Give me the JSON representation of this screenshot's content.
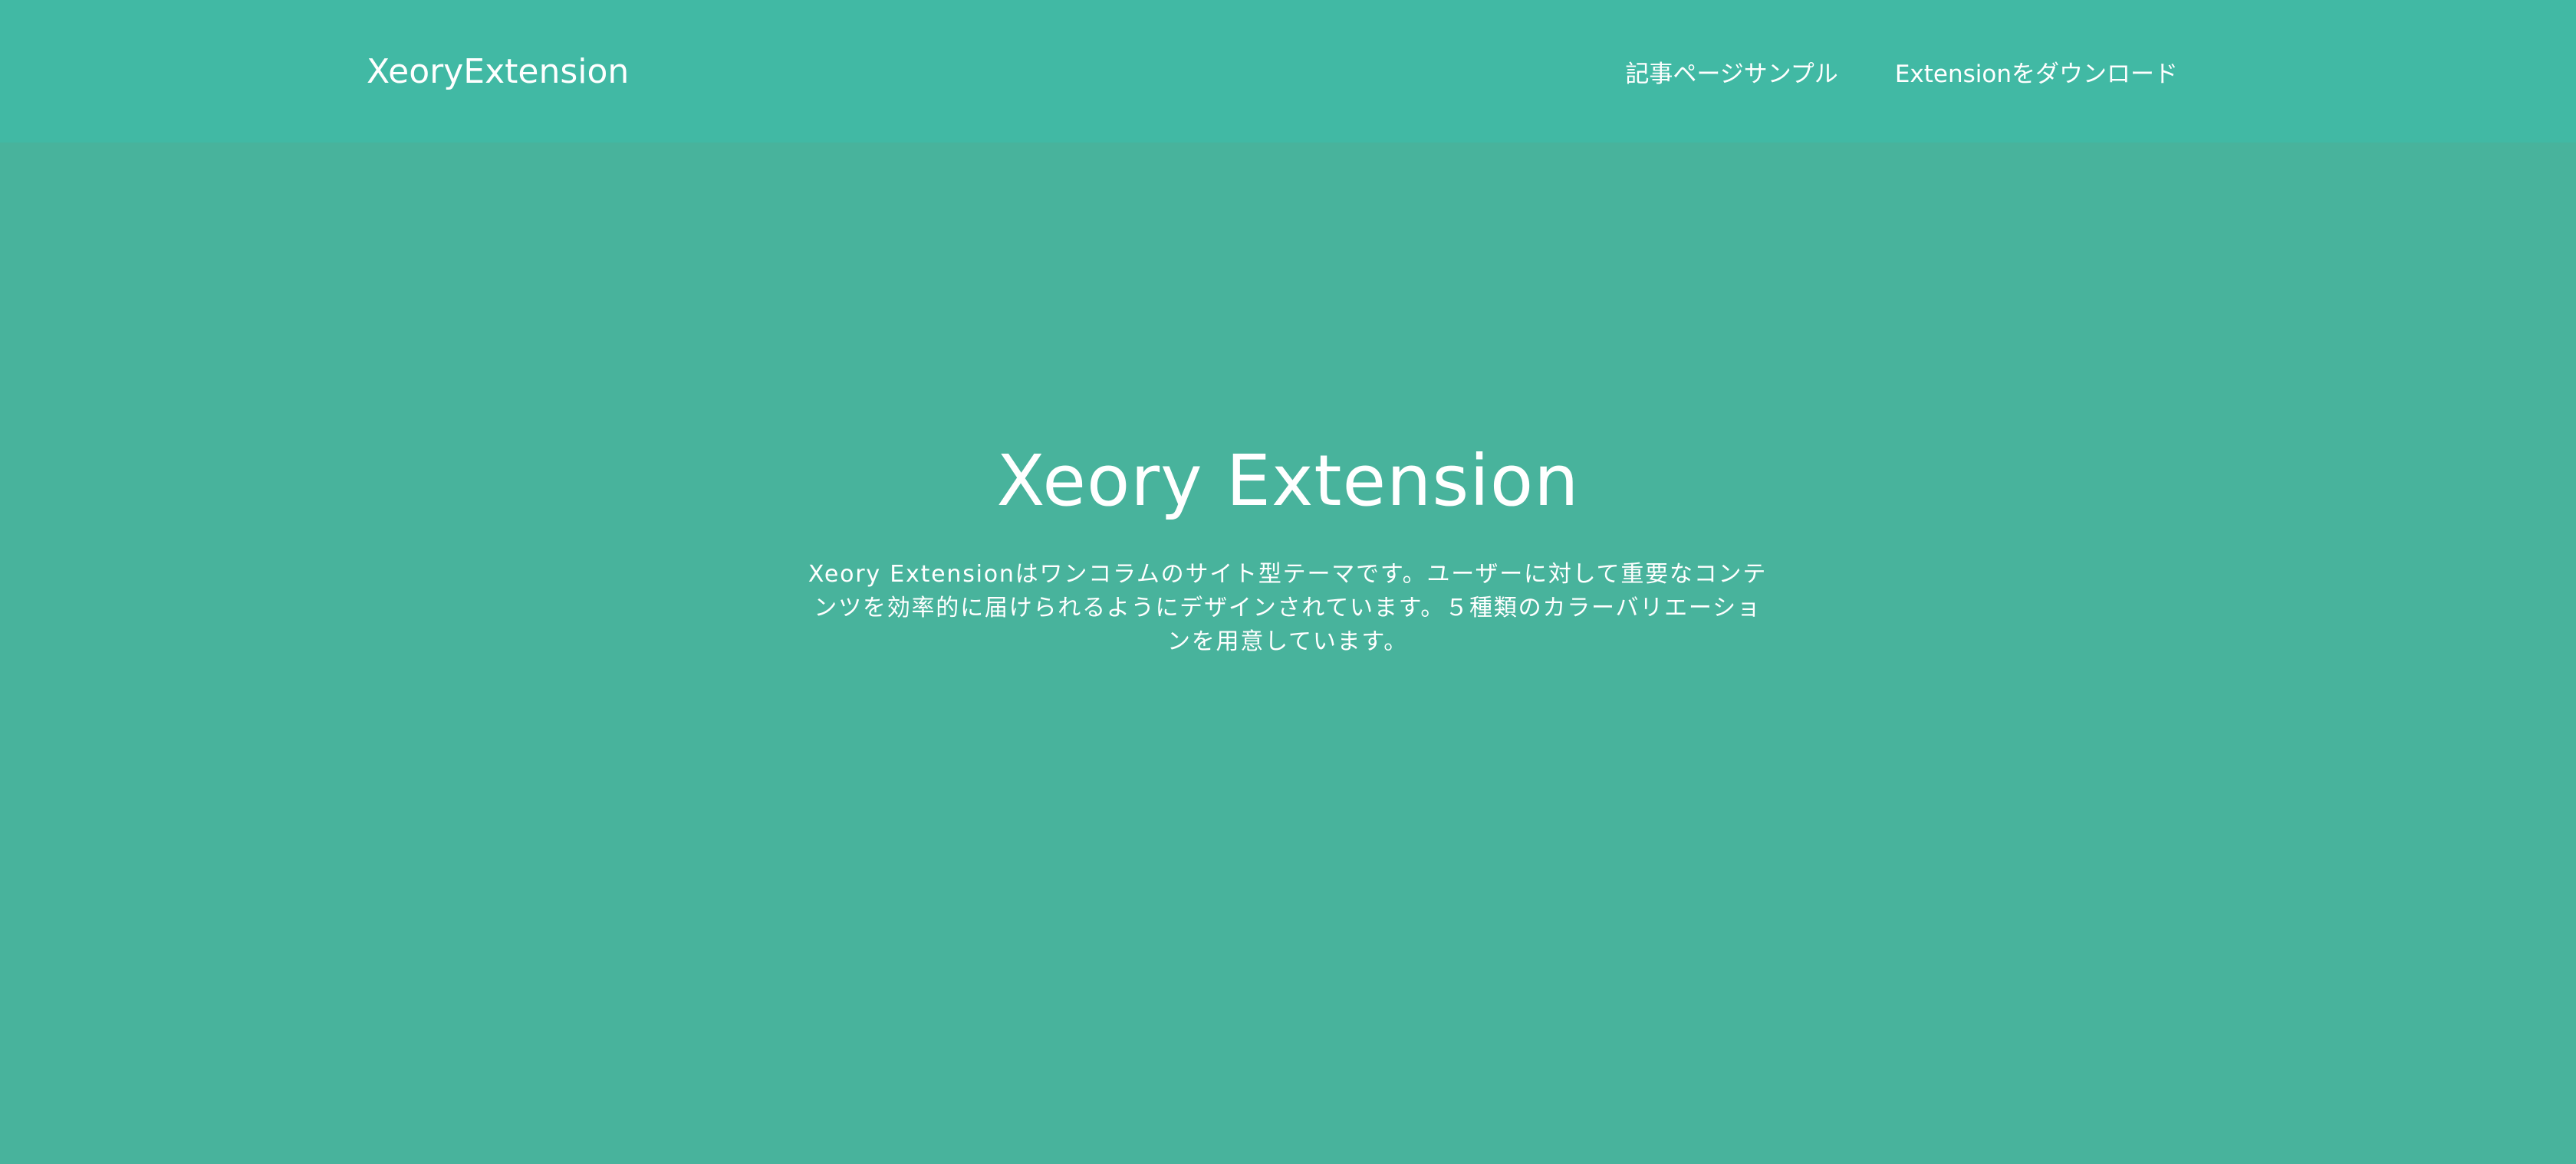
{
  "header": {
    "logo": "XeoryExtension",
    "nav": [
      {
        "label": "記事ページサンプル"
      },
      {
        "label": "Extensionをダウンロード"
      }
    ]
  },
  "hero": {
    "title": "Xeory Extension",
    "description": "Xeory Extensionはワンコラムのサイト型テーマです。ユーザーに対して重要なコンテンツを効率的に届けられるようにデザインされています。５種類のカラーバリエーションを用意しています。"
  },
  "colors": {
    "header": "#41b9a4",
    "hero": "#48b39c",
    "text": "#ffffff"
  }
}
